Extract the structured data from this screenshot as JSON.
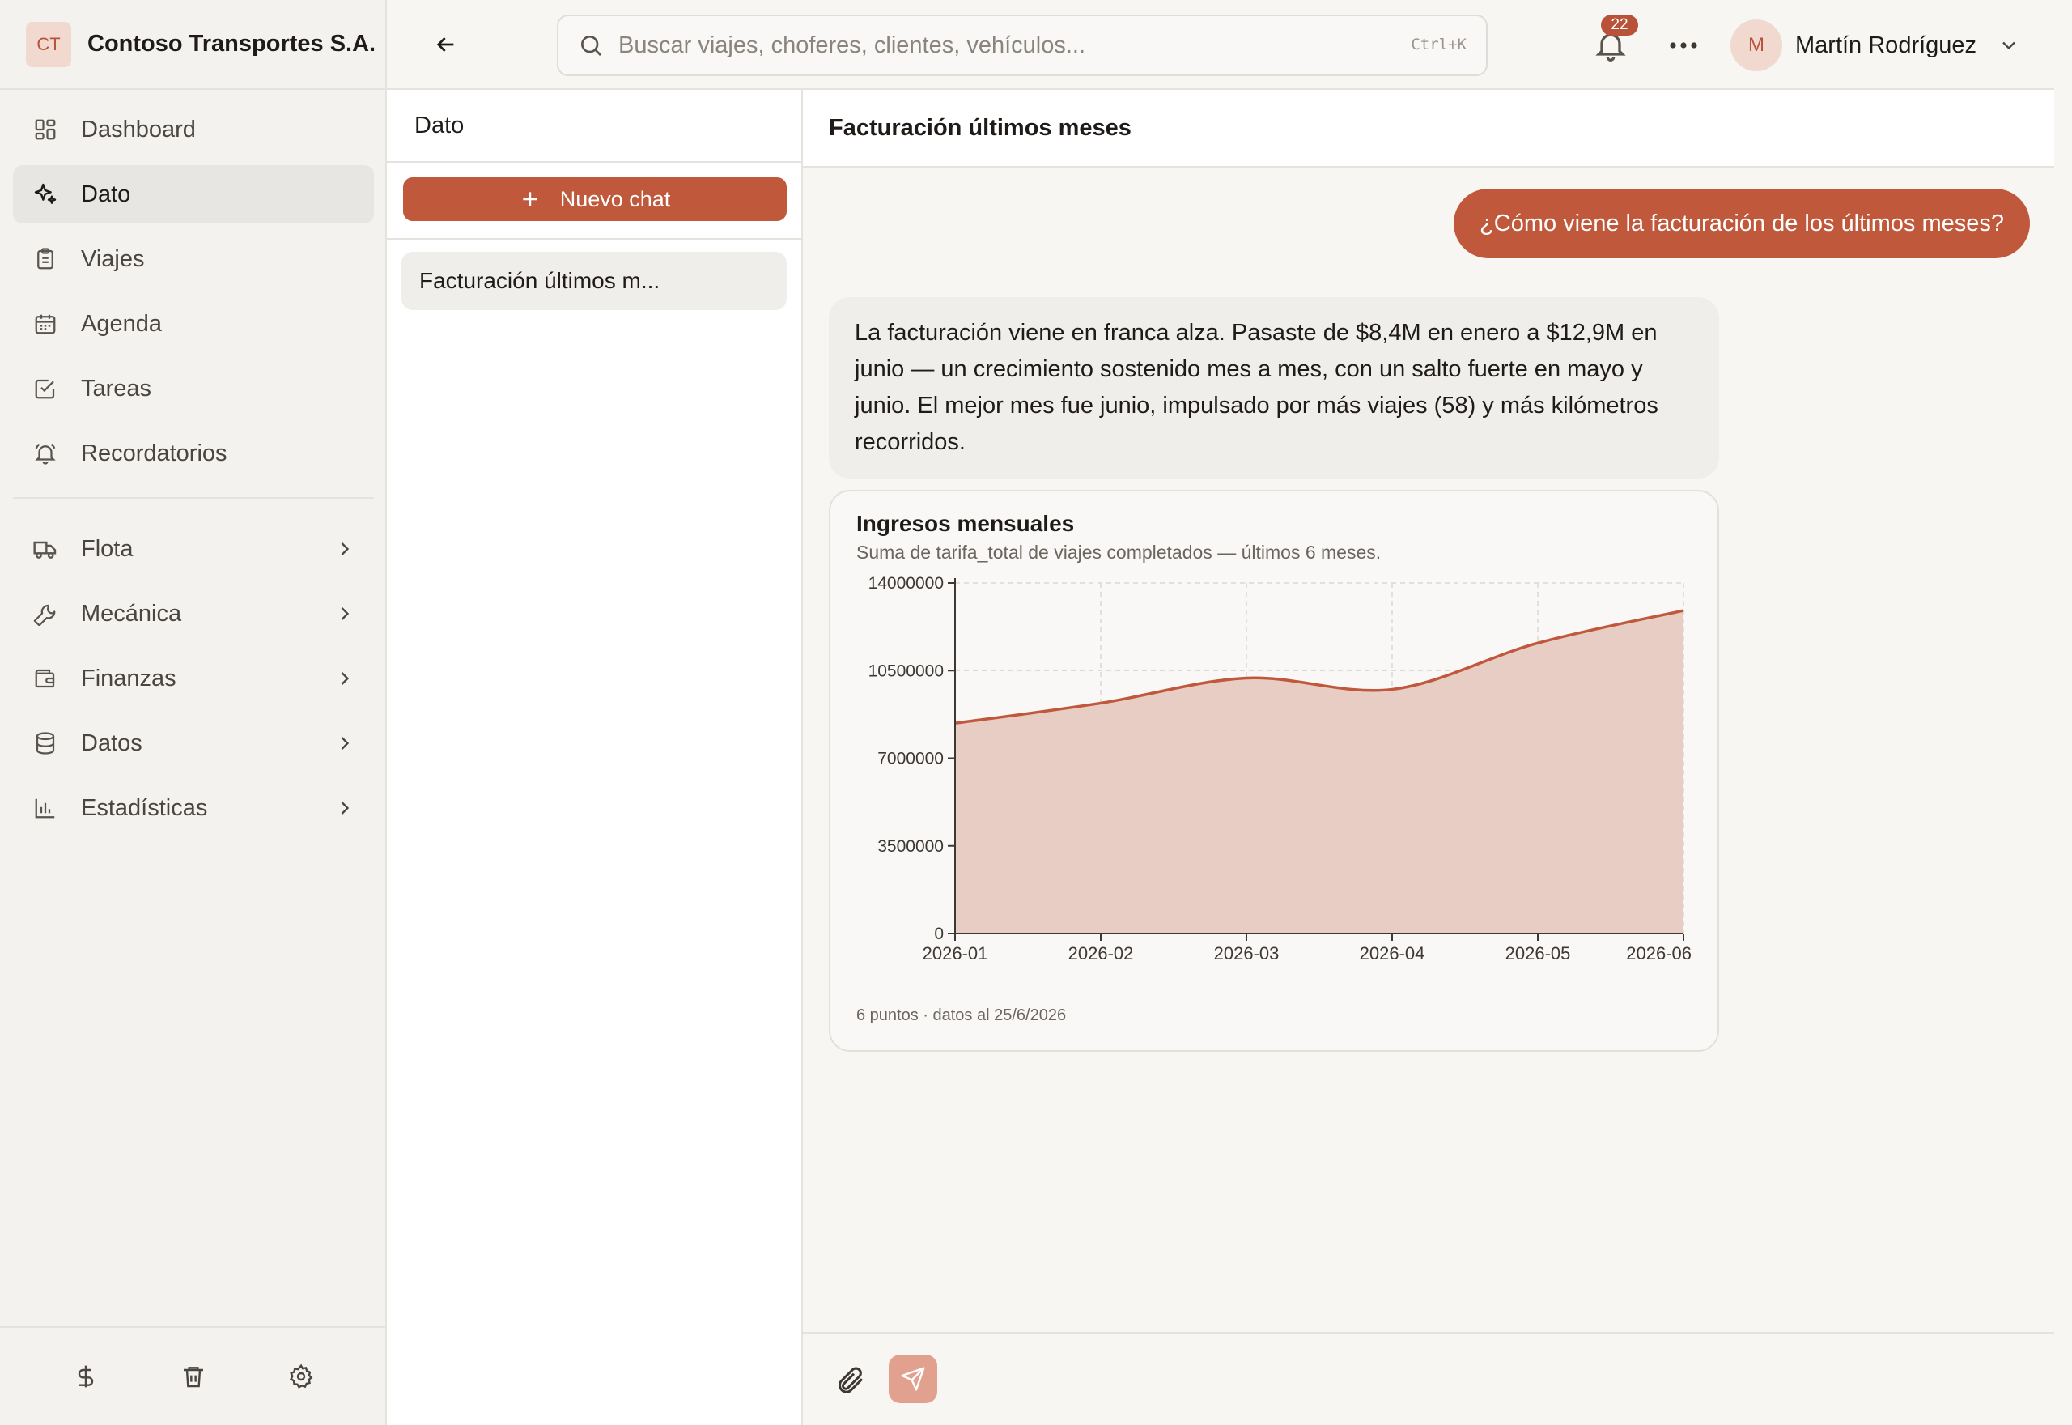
{
  "brand": {
    "initials": "CT",
    "name": "Contoso Transportes S.A."
  },
  "sidebar": {
    "items": [
      {
        "label": "Dashboard",
        "icon": "dashboard-icon"
      },
      {
        "label": "Dato",
        "icon": "sparkle-icon",
        "active": true
      },
      {
        "label": "Viajes",
        "icon": "clipboard-icon"
      },
      {
        "label": "Agenda",
        "icon": "calendar-icon"
      },
      {
        "label": "Tareas",
        "icon": "checkbox-icon"
      },
      {
        "label": "Recordatorios",
        "icon": "bell-icon"
      }
    ],
    "groups": [
      {
        "label": "Flota",
        "icon": "truck-icon"
      },
      {
        "label": "Mecánica",
        "icon": "wrench-icon"
      },
      {
        "label": "Finanzas",
        "icon": "wallet-icon"
      },
      {
        "label": "Datos",
        "icon": "database-icon"
      },
      {
        "label": "Estadísticas",
        "icon": "bar-chart-icon"
      }
    ],
    "footer": [
      "dollar-icon",
      "trash-icon",
      "gear-icon"
    ]
  },
  "topbar": {
    "search_placeholder": "Buscar viajes, choferes, clientes, vehículos...",
    "search_shortcut": "Ctrl+K",
    "notifications_count": "22",
    "user_initial": "M",
    "user_name": "Martín Rodríguez"
  },
  "chatlist": {
    "title": "Dato",
    "new_chat_label": "Nuevo chat",
    "entries": [
      {
        "label": "Facturación últimos m..."
      }
    ]
  },
  "conversation": {
    "title": "Facturación últimos meses",
    "user_message": "¿Cómo viene la facturación de los últimos meses?",
    "bot_message": "La facturación viene en franca alza. Pasaste de $8,4M en enero a $12,9M en junio — un crecimiento sostenido mes a mes, con un salto fuerte en mayo y junio. El mejor mes fue junio, impulsado por más viajes (58) y más kilómetros recorridos.",
    "chart_footer": "6 puntos · datos al 25/6/2026"
  },
  "chart_data": {
    "type": "area",
    "title": "Ingresos mensuales",
    "subtitle": "Suma de tarifa_total de viajes completados — últimos 6 meses.",
    "x": [
      "2026-01",
      "2026-02",
      "2026-03",
      "2026-04",
      "2026-05",
      "2026-06"
    ],
    "values": [
      8400000,
      9200000,
      10200000,
      9750000,
      11600000,
      12900000
    ],
    "ylim": [
      0,
      14000000
    ],
    "yticks": [
      0,
      3500000,
      7000000,
      10500000,
      14000000
    ],
    "grid": true,
    "colors": {
      "line": "#c0583b",
      "fill": "#e8cdc4"
    }
  }
}
